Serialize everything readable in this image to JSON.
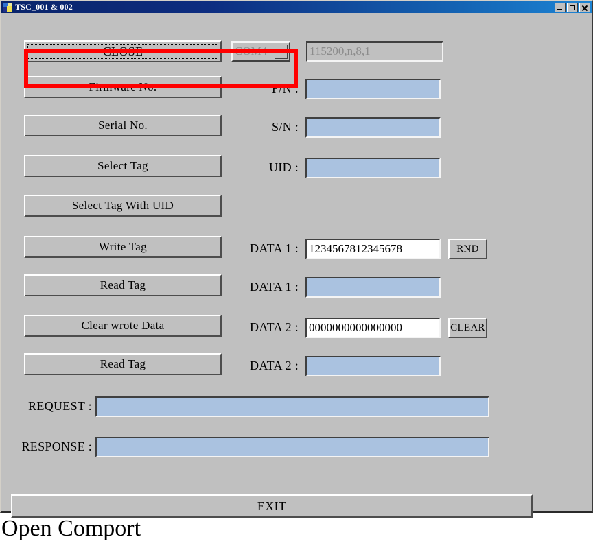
{
  "window": {
    "title": "TSC_001 & 002",
    "icon": "app-icon",
    "controls": {
      "minimize": "minimize-icon",
      "maximize": "maximize-icon",
      "close": "close-icon"
    }
  },
  "connection": {
    "toggle_label": "CLOSE",
    "com_port": "COM4",
    "com_dropdown_arrow": "chevron-down-icon",
    "serial_settings": "115200,n,8,1",
    "com_disabled": true,
    "serial_settings_disabled": true
  },
  "annotation": {
    "highlight_color": "#ff0000"
  },
  "rows": [
    {
      "button": "Firmware No.",
      "label": "F/N :",
      "value": "",
      "editable": false
    },
    {
      "button": "Serial No.",
      "label": "S/N :",
      "value": "",
      "editable": false
    },
    {
      "button": "Select Tag",
      "label": "UID :",
      "value": "",
      "editable": false
    },
    {
      "button": "Select Tag With UID",
      "label": "",
      "value": "",
      "editable": false
    },
    {
      "button": "Write Tag",
      "label": "DATA 1 :",
      "value": "1234567812345678",
      "editable": true,
      "side_button": "RND"
    },
    {
      "button": "Read Tag",
      "label": "DATA 1 :",
      "value": "",
      "editable": false
    },
    {
      "button": "Clear wrote Data",
      "label": "DATA 2 :",
      "value": "0000000000000000",
      "editable": true,
      "side_button": "CLEAR"
    },
    {
      "button": "Read Tag",
      "label": "DATA 2 :",
      "value": "",
      "editable": false
    }
  ],
  "log": {
    "request_label": "REQUEST :",
    "request_value": "",
    "response_label": "RESPONSE :",
    "response_value": ""
  },
  "exit_label": "EXIT",
  "caption": "Open Comport",
  "colors": {
    "window_face": "#c0c0c0",
    "field_fill": "#aac2e0",
    "field_editable_fill": "#ffffff",
    "title_bar_start": "#0a246a",
    "title_bar_end": "#1d84d4",
    "highlight": "#ff0000"
  }
}
